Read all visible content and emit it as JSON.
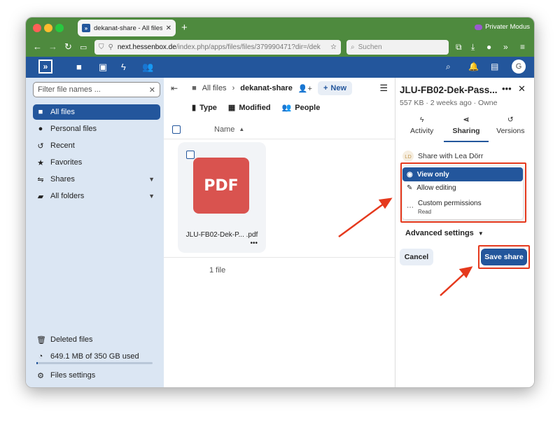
{
  "browser": {
    "tab_title": "dekanat-share - All files - Files",
    "tab_favicon": "»",
    "private_mode": "Privater Modus",
    "url_host": "next.hessenbox.de",
    "url_path": "/index.php/apps/files/files/379990471?dir=/dek",
    "search_placeholder": "Suchen"
  },
  "header": {
    "logo": "»",
    "avatar_initial": "G"
  },
  "leftnav": {
    "filter_placeholder": "Filter file names ...",
    "items": [
      {
        "label": "All files",
        "icon": "folder-icon"
      },
      {
        "label": "Personal files",
        "icon": "person-icon"
      },
      {
        "label": "Recent",
        "icon": "history-icon"
      },
      {
        "label": "Favorites",
        "icon": "star-icon"
      },
      {
        "label": "Shares",
        "icon": "share-icon"
      },
      {
        "label": "All folders",
        "icon": "folders-icon"
      }
    ],
    "deleted_files": "Deleted files",
    "quota": "649.1 MB of 350 GB used",
    "quota_fraction": 0.002,
    "settings": "Files settings"
  },
  "main": {
    "crumb_root": "All files",
    "crumb_current": "dekanat-share",
    "new_label": "New",
    "filters": {
      "type": "Type",
      "modified": "Modified",
      "people": "People"
    },
    "col_name": "Name",
    "file_thumb_text": "PDF",
    "file_name": "JLU-FB02-Dek-P... .pdf",
    "summary": "1 file"
  },
  "sidebar": {
    "title": "JLU-FB02-Dek-Pass...",
    "meta": "557 KB  ·  2 weeks ago  ·  Owne",
    "tabs": [
      {
        "label": "Activity",
        "icon": "activity-icon"
      },
      {
        "label": "Sharing",
        "icon": "share-icon"
      },
      {
        "label": "Versions",
        "icon": "history-icon"
      }
    ],
    "share_with_initials": "LD",
    "share_with": "Share with Lea Dörr",
    "permissions": [
      {
        "label": "View only",
        "selected": true
      },
      {
        "label": "Allow editing",
        "selected": false
      },
      {
        "label": "Custom permissions",
        "sub": "Read",
        "selected": false
      }
    ],
    "advanced": "Advanced settings",
    "cancel": "Cancel",
    "save": "Save share"
  },
  "colors": {
    "brand_blue": "#23569c",
    "browser_green": "#4e8a3e",
    "annotation_red": "#e5391d",
    "pdf_red": "#d9534f"
  }
}
